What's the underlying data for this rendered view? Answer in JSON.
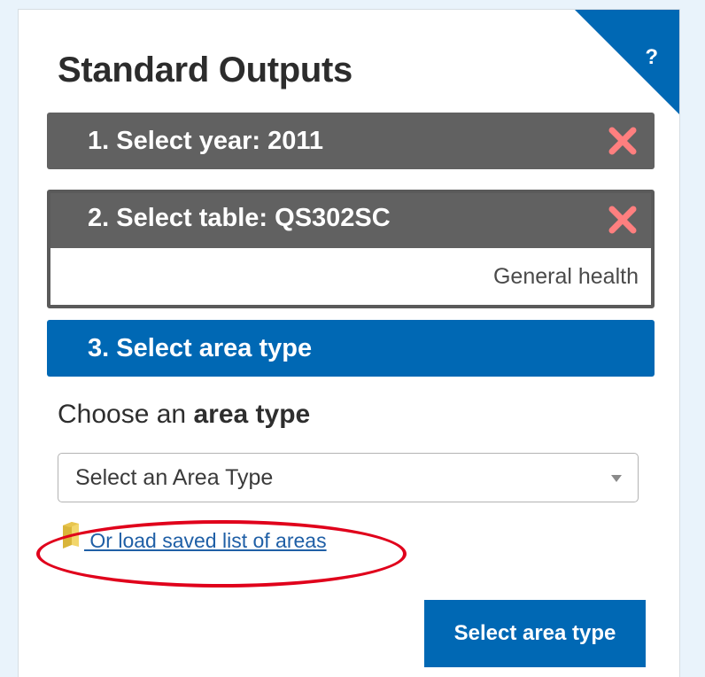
{
  "panel": {
    "title": "Standard Outputs",
    "help_label": "?"
  },
  "steps": [
    {
      "label": "1. Select year: 2011",
      "state": "completed",
      "remove_icon": "close-x-icon"
    },
    {
      "label": "2. Select table: QS302SC",
      "state": "completed",
      "description": "General health",
      "remove_icon": "close-x-icon"
    },
    {
      "label": "3. Select area type",
      "state": "current"
    }
  ],
  "area_type": {
    "prompt_prefix": "Choose an ",
    "prompt_bold": "area type",
    "select_value": "Select an Area Type",
    "load_saved_link": " Or load saved list of areas",
    "load_icon": "folder-icon"
  },
  "actions": {
    "submit_label": "Select area type"
  },
  "colors": {
    "brand_blue": "#0068b4",
    "completed_grey": "#616161",
    "remove_x": "#ff7f7f",
    "annotation_red": "#e0001b",
    "link_blue": "#1f5fa6"
  }
}
